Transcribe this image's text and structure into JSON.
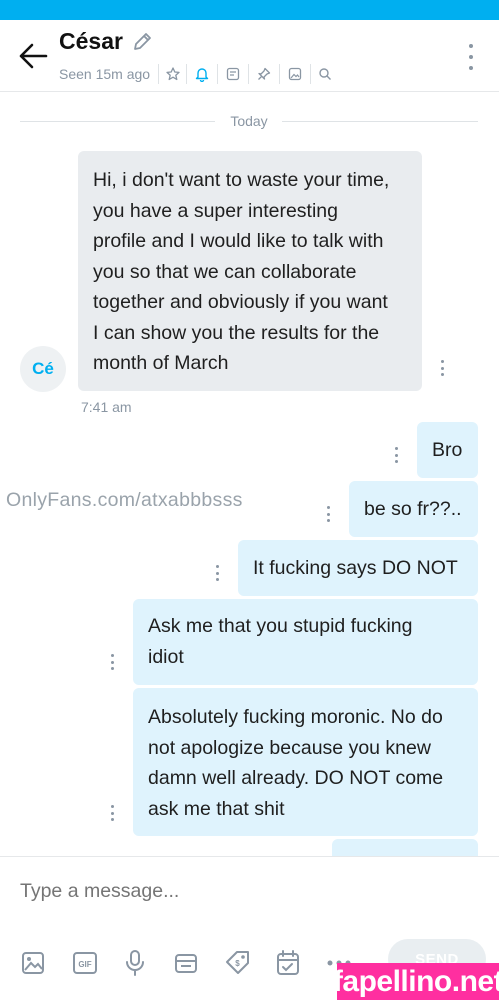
{
  "header": {
    "contact_name": "César",
    "seen_status": "Seen 15m ago",
    "icons": [
      "back-arrow-icon",
      "edit-icon",
      "star-icon",
      "bell-icon",
      "note-icon",
      "pin-icon",
      "media-icon",
      "search-icon",
      "more-icon"
    ]
  },
  "thread": {
    "date_divider": "Today",
    "avatar_initials": "Cé",
    "messages": [
      {
        "direction": "incoming",
        "lines": [
          "Hi, i don't want to waste your time,",
          "you have a super interesting",
          "profile and I would like to talk with",
          "you so that we can collaborate",
          "together and obviously if you want",
          "I can show you the results for the",
          "month of March"
        ],
        "time": "7:41 am"
      },
      {
        "direction": "outgoing",
        "lines": [
          "Bro"
        ]
      },
      {
        "direction": "outgoing",
        "lines": [
          "be so fr??.."
        ]
      },
      {
        "direction": "outgoing",
        "lines": [
          "It fucking says DO NOT"
        ]
      },
      {
        "direction": "outgoing",
        "lines": [
          "Ask me that you stupid fucking",
          "idiot"
        ]
      },
      {
        "direction": "outgoing",
        "lines": [
          "Absolutely fucking moronic. No do",
          "not apologize because you knew",
          "damn well already. DO NOT come",
          "ask me that shit"
        ]
      }
    ]
  },
  "overlay": {
    "watermark_text": "OnlyFans.com/atxabbbsss",
    "brand_text": "fapellino.net"
  },
  "composer": {
    "placeholder": "Type a message...",
    "send_label": "SEND",
    "tools": [
      "image-icon",
      "gif-icon",
      "microphone-icon",
      "calendar-media-icon",
      "price-tag-icon",
      "schedule-icon",
      "more-options-icon"
    ]
  },
  "colors": {
    "accent": "#00aff0",
    "incoming_bubble": "#e9ecef",
    "outgoing_bubble": "#dff3fd",
    "muted_text": "#8a96a3",
    "brand": "#ff2fa0"
  }
}
